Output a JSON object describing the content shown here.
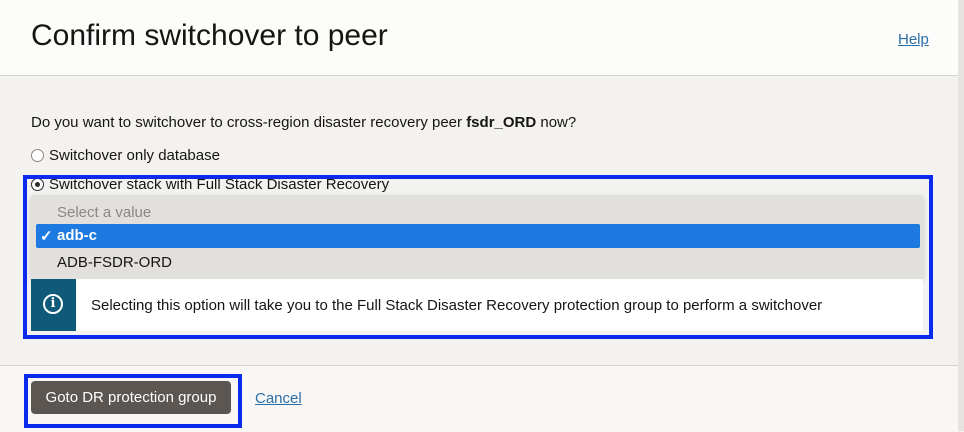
{
  "dialog": {
    "title": "Confirm switchover to peer",
    "help_label": "Help"
  },
  "question": {
    "prefix": "Do you want to switchover to cross-region disaster recovery peer ",
    "peer": "fsdr_ORD",
    "suffix": " now?"
  },
  "options": [
    {
      "label": "Switchover only database",
      "selected": false
    },
    {
      "label": "Switchover stack with Full Stack Disaster Recovery",
      "selected": true
    }
  ],
  "dropdown": {
    "placeholder": "Select a value",
    "check_glyph": "✓",
    "items": [
      {
        "label": "adb-c",
        "selected": true
      },
      {
        "label": "ADB-FSDR-ORD",
        "selected": false
      }
    ]
  },
  "info": {
    "icon": "info-icon",
    "icon_glyph": "i",
    "text": "Selecting this option will take you to the Full Stack Disaster Recovery protection group to perform a switchover"
  },
  "footer": {
    "primary_label": "Goto DR protection group",
    "cancel_label": "Cancel"
  },
  "colors": {
    "accent_highlight": "#0a2bef",
    "selected_item": "#1c7ae0",
    "info_bar": "#0e5a78",
    "primary_button": "#5b5652",
    "link": "#2b6fa8"
  }
}
